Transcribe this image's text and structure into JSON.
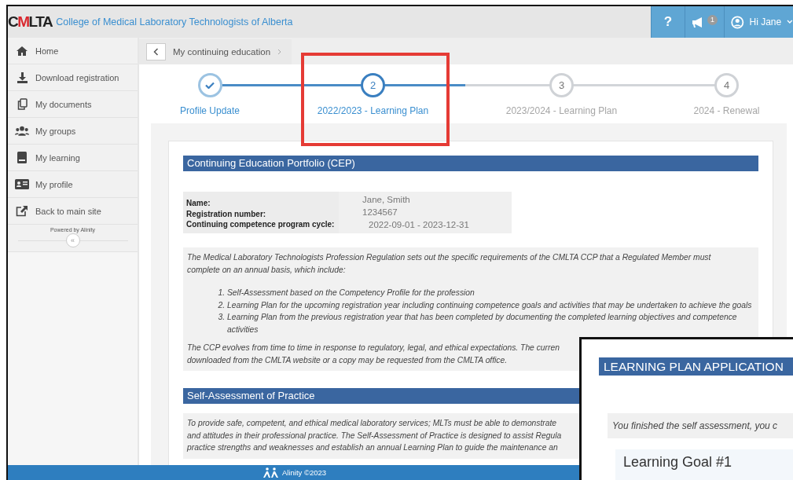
{
  "header": {
    "logo": "CMLTA",
    "title": "College of Medical Laboratory Technologists of Alberta",
    "help": "?",
    "notification_count": "1",
    "greeting": "Hi Jane"
  },
  "sidebar": {
    "items": [
      {
        "label": "Home",
        "kind": "home"
      },
      {
        "label": "Download registration",
        "kind": "download"
      },
      {
        "label": "My documents",
        "kind": "documents"
      },
      {
        "label": "My groups",
        "kind": "groups"
      },
      {
        "label": "My learning",
        "kind": "learning"
      },
      {
        "label": "My profile",
        "kind": "profile"
      },
      {
        "label": "Back to main site",
        "kind": "external"
      }
    ],
    "powered_by": "Powered by Alinity",
    "collapse": "«"
  },
  "breadcrumb": {
    "label": "My continuing education"
  },
  "steps": [
    {
      "label": "Profile Update",
      "completed": true,
      "selected": false
    },
    {
      "number": "2",
      "label": "2022/2023 - Learning Plan",
      "completed": false,
      "selected": true
    },
    {
      "number": "3",
      "label": "2023/2024 - Learning Plan",
      "completed": false,
      "selected": false
    },
    {
      "number": "4",
      "label": "2024 - Renewal",
      "completed": false,
      "selected": false
    }
  ],
  "portfolio": {
    "heading": "Continuing Education Portfolio (CEP)",
    "fields": [
      {
        "label": "Name:",
        "value": "Jane, Smith"
      },
      {
        "label": "Registration number:",
        "value": "1234567"
      },
      {
        "label": "Continuing competence program cycle:",
        "value": "2022-09-01 - 2023-12-31"
      }
    ],
    "intro": [
      "The Medical Laboratory Technologists Profession Regulation sets out the specific requirements of the CMLTA CCP that a Regulated Member must",
      "complete on an annual basis, which include:"
    ],
    "requirements": [
      {
        "number": "1.",
        "text": "Self-Assessment based on the Competency Profile for the profession"
      },
      {
        "number": "2.",
        "text": "Learning Plan for the upcoming registration year including continuing competence goals and activities that may be undertaken to achieve the goals"
      },
      {
        "number": "3.",
        "text": "Learning Plan from the previous registration year that has been completed by documenting the completed learning objectives and competence activities"
      }
    ],
    "closing": [
      "The CCP evolves from time to time in response to regulatory, legal, and ethical expectations. The curren",
      "downloaded from the CMLTA website or a copy may be requested from the CMLTA office."
    ]
  },
  "self_assessment": {
    "heading": "Self-Assessment of Practice",
    "text": [
      "To provide safe, competent, and ethical medical laboratory services; MLTs must be able to demonstrate",
      "and attitudes in their professional practice. The Self-Assessment of Practice is designed to assist Regula",
      "practice strengths and weaknesses and establish an annual Learning Plan to guide the maintenance an"
    ]
  },
  "footer": {
    "text": "Alinity ©2023"
  },
  "inset": {
    "heading": "LEARNING PLAN APPLICATION",
    "message": "You finished the self assessment, you c",
    "goal_title": "Learning Goal #1"
  }
}
